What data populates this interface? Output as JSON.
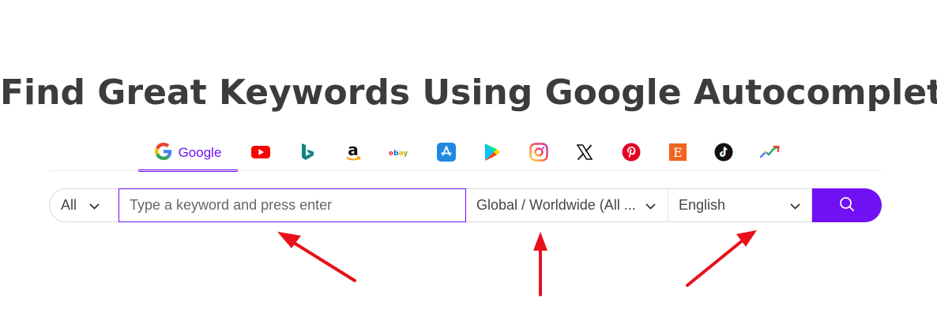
{
  "title": "Find Great Keywords Using Google Autocomplete",
  "tabs": [
    {
      "label": "Google",
      "icon": "google-icon",
      "active": true
    },
    {
      "icon": "youtube-icon"
    },
    {
      "icon": "bing-icon"
    },
    {
      "icon": "amazon-icon"
    },
    {
      "icon": "ebay-icon"
    },
    {
      "icon": "app-store-icon"
    },
    {
      "icon": "google-play-icon"
    },
    {
      "icon": "instagram-icon"
    },
    {
      "icon": "x-icon"
    },
    {
      "icon": "pinterest-icon"
    },
    {
      "icon": "etsy-icon"
    },
    {
      "icon": "tiktok-icon"
    },
    {
      "icon": "trends-icon"
    }
  ],
  "search": {
    "scope_value": "All",
    "placeholder": "Type a keyword and press enter",
    "country_value": "Global / Worldwide (All ...",
    "language_value": "English"
  },
  "colors": {
    "accent": "#7010f5",
    "arrow": "#e8101a"
  }
}
